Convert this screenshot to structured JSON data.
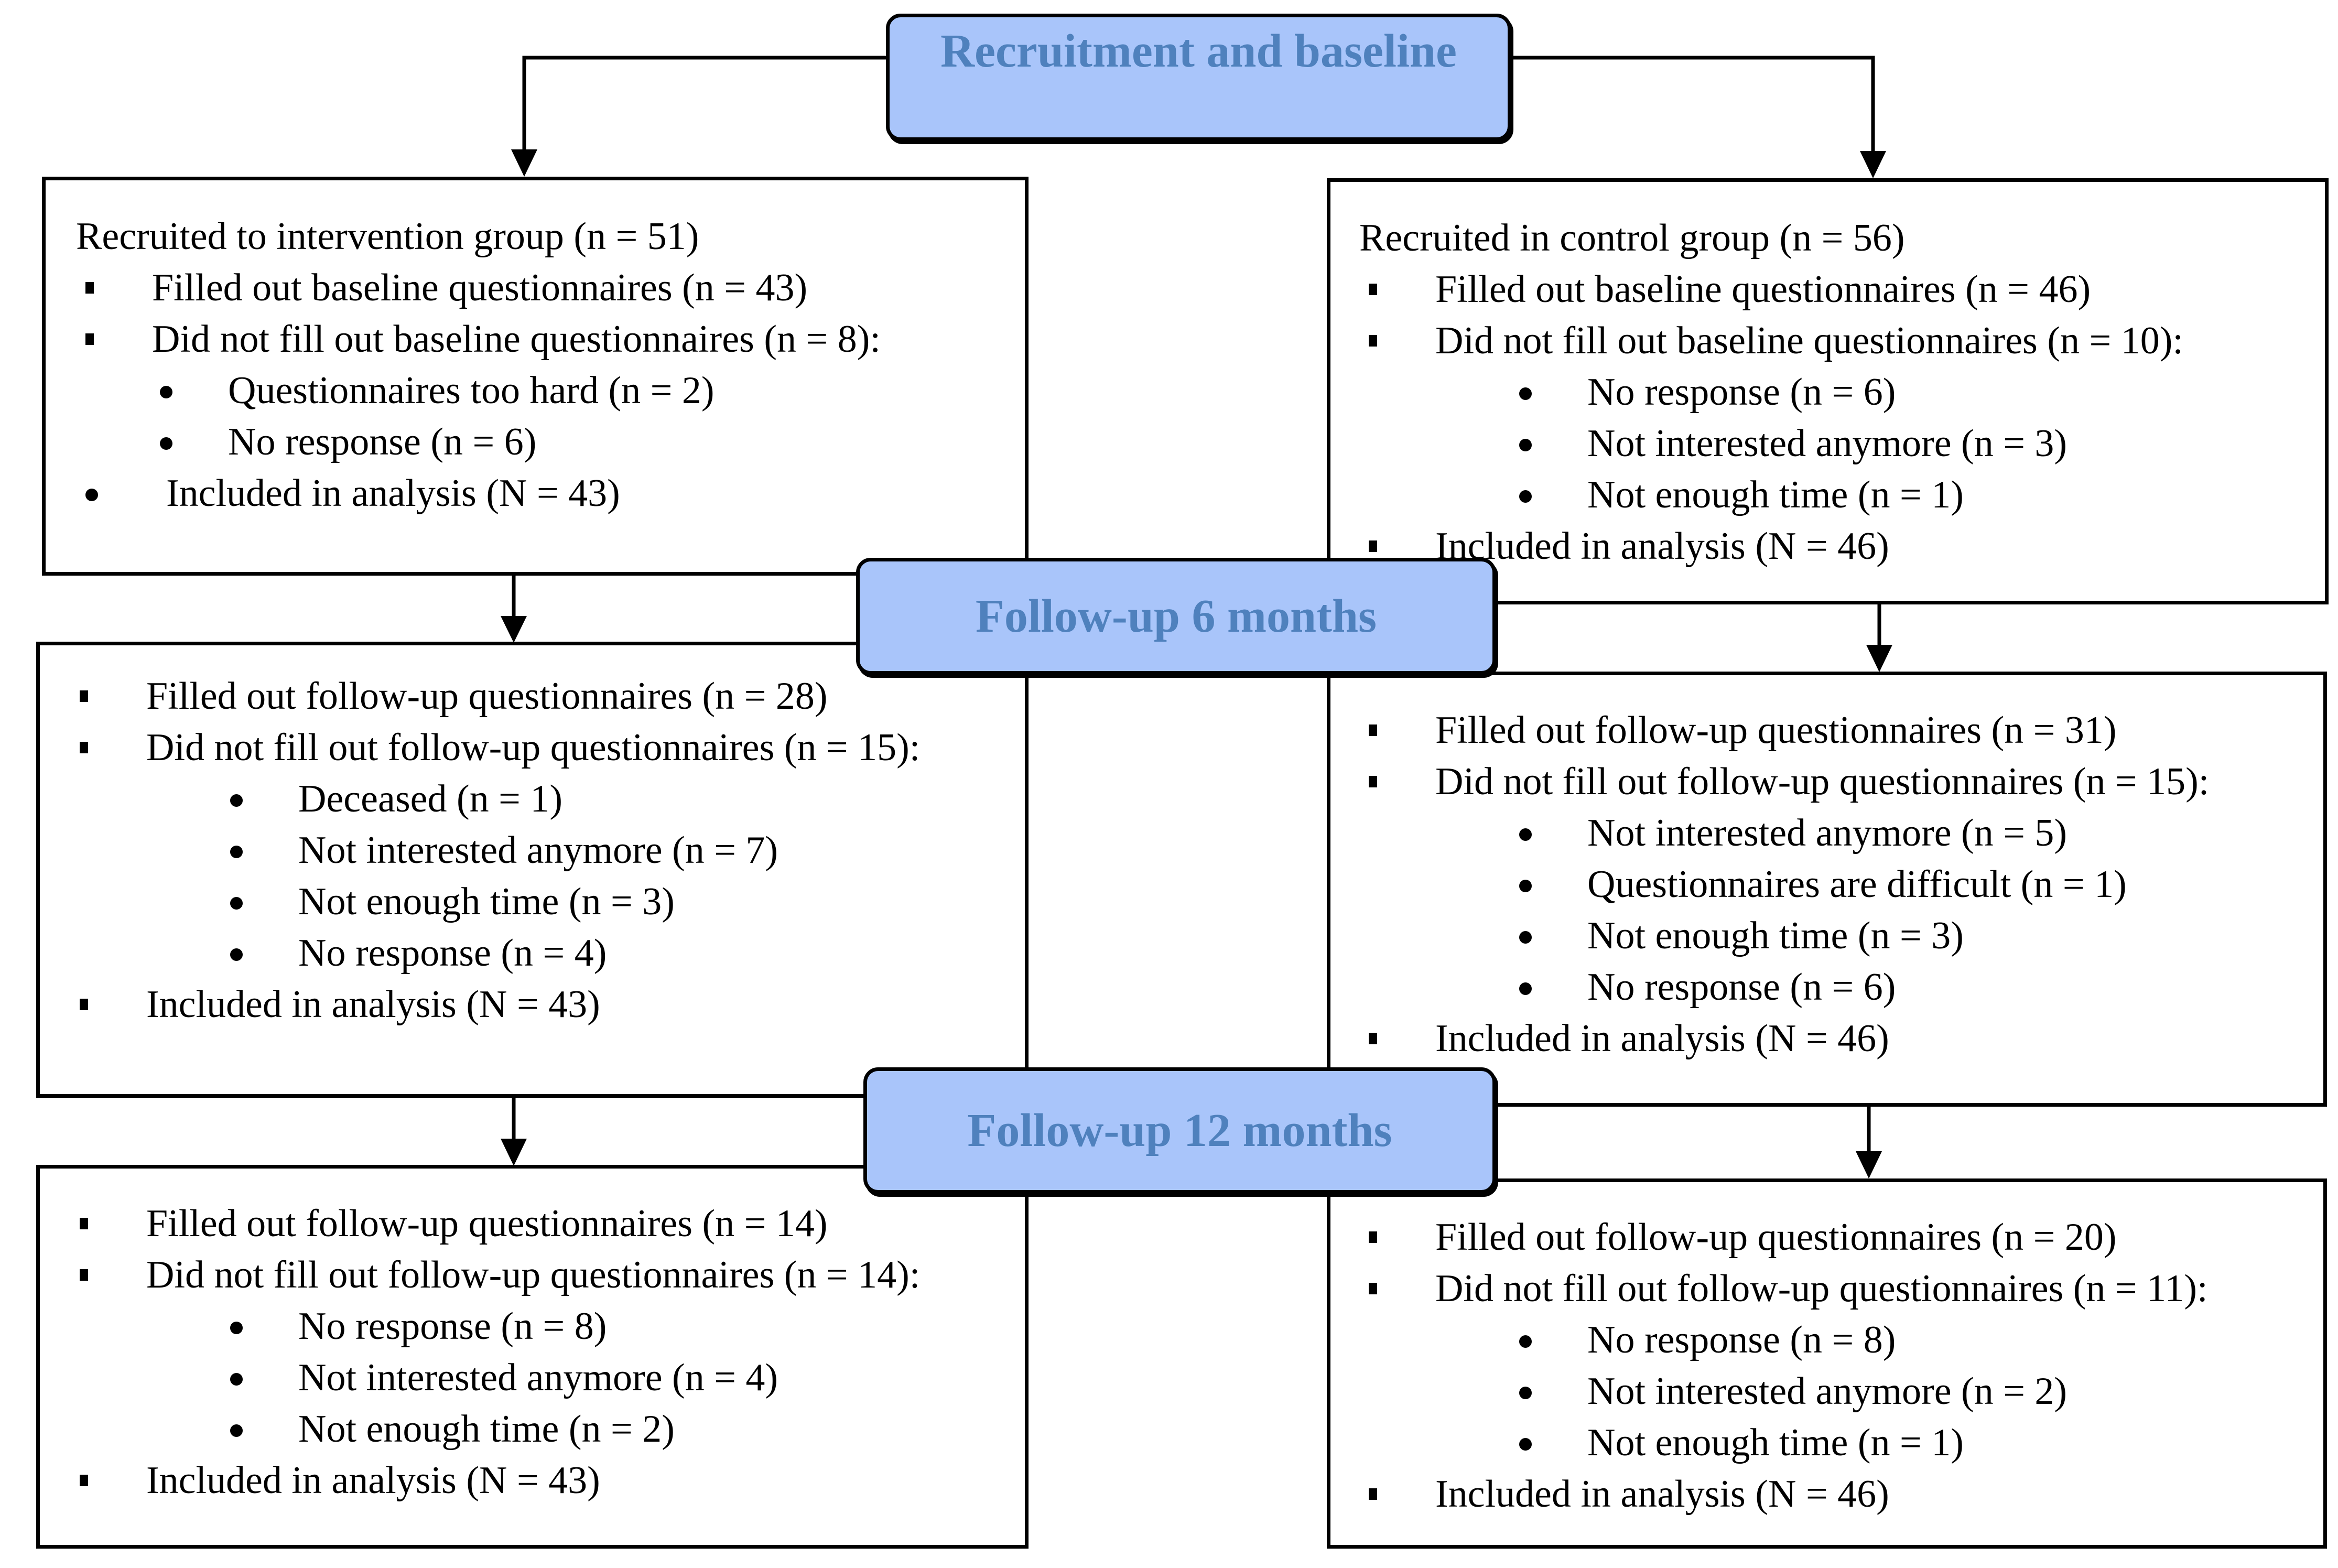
{
  "stages": {
    "recruitment": "Recruitment and baseline",
    "followup6": "Follow-up 6 months",
    "followup12": "Follow-up 12 months"
  },
  "colors": {
    "banner_fill": "#A9C5FA",
    "banner_text": "#4F81BD",
    "border": "#000000"
  },
  "intervention": {
    "baseline": {
      "title": "Recruited to intervention group (n = 51)",
      "filled": "Filled out baseline questionnaires (n = 43)",
      "not_filled": "Did not fill out baseline questionnaires (n = 8):",
      "reasons": [
        "Questionnaires too hard (n = 2)",
        "No response (n = 6)"
      ],
      "included": "Included in analysis (N = 43)"
    },
    "followup6": {
      "filled": "Filled out follow-up questionnaires (n = 28)",
      "not_filled": "Did not fill out follow-up questionnaires (n = 15):",
      "reasons": [
        "Deceased (n = 1)",
        "Not interested anymore (n = 7)",
        "Not enough time (n = 3)",
        "No response (n = 4)"
      ],
      "included": "Included in analysis (N = 43)"
    },
    "followup12": {
      "filled": "Filled out follow-up questionnaires (n = 14)",
      "not_filled": "Did not fill out follow-up questionnaires (n = 14):",
      "reasons": [
        "No response (n = 8)",
        "Not interested anymore (n = 4)",
        "Not enough time (n = 2)"
      ],
      "included": "Included in analysis (N = 43)"
    }
  },
  "control": {
    "baseline": {
      "title": "Recruited in control group (n = 56)",
      "filled": "Filled out baseline questionnaires (n = 46)",
      "not_filled": "Did not fill out baseline questionnaires (n = 10):",
      "reasons": [
        "No response (n = 6)",
        "Not interested anymore (n = 3)",
        "Not enough time (n = 1)"
      ],
      "included": "Included in analysis (N = 46)"
    },
    "followup6": {
      "filled": "Filled out follow-up questionnaires (n = 31)",
      "not_filled": "Did not fill out follow-up questionnaires (n = 15):",
      "reasons": [
        "Not interested anymore (n = 5)",
        "Questionnaires are difficult (n = 1)",
        "Not enough time (n = 3)",
        "No response (n = 6)"
      ],
      "included": "Included in analysis (N = 46)"
    },
    "followup12": {
      "filled": "Filled out follow-up questionnaires (n = 20)",
      "not_filled": "Did not fill out follow-up questionnaires (n = 11):",
      "reasons": [
        "No response (n = 8)",
        "Not interested anymore (n = 2)",
        "Not enough time (n = 1)"
      ],
      "included": "Included in analysis (N = 46)"
    }
  }
}
